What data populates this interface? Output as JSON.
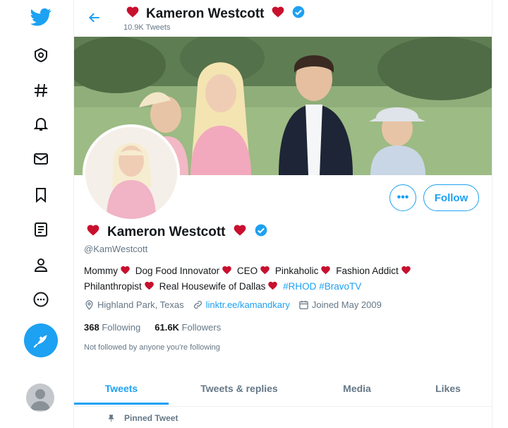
{
  "header": {
    "name": "Kameron Westcott",
    "tweet_count": "10.9K Tweets"
  },
  "profile": {
    "name": "Kameron Westcott",
    "handle": "@KamWestcott",
    "bio_parts": [
      "Mommy",
      "Dog Food Innovator",
      "CEO",
      "Pinkaholic",
      "Fashion Addict",
      "Philanthropist",
      "Real Housewife of Dallas"
    ],
    "hashtags": [
      "#RHOD",
      "#BravoTV"
    ],
    "location": "Highland Park, Texas",
    "website": "linktr.ee/kamandkary",
    "joined": "Joined May 2009",
    "following_count": "368",
    "following_label": "Following",
    "followers_count": "61.6K",
    "followers_label": "Followers",
    "not_followed": "Not followed by anyone you're following"
  },
  "actions": {
    "more": "•••",
    "follow": "Follow"
  },
  "tabs": [
    "Tweets",
    "Tweets & replies",
    "Media",
    "Likes"
  ],
  "pinned_label": "Pinned Tweet",
  "sidebar_icons": [
    "twitter-logo-icon",
    "home-icon",
    "explore-hashtag-icon",
    "notifications-bell-icon",
    "messages-envelope-icon",
    "bookmarks-icon",
    "lists-icon",
    "profile-icon",
    "more-icon",
    "compose-tweet-icon"
  ],
  "colors": {
    "accent": "#1da1f2",
    "heart": "#c8102e",
    "muted": "#657786"
  }
}
